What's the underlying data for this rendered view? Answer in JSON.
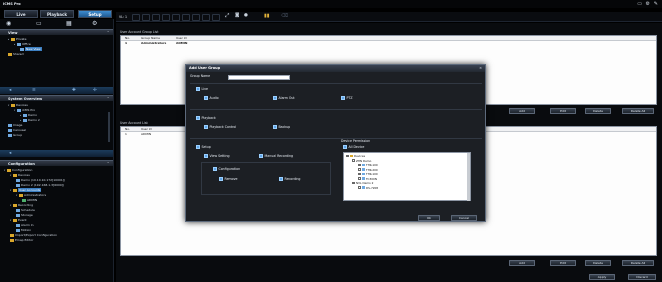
{
  "app": {
    "title": "iCMS Pro"
  },
  "window_controls": {
    "icons": [
      "screen-icon",
      "gear-icon",
      "pin-icon"
    ]
  },
  "tabs": [
    {
      "label": "Live"
    },
    {
      "label": "Playback"
    },
    {
      "label": "Setup",
      "active": true
    }
  ],
  "toolbar": {
    "view_label": "VL: 1"
  },
  "left_panel": {
    "view_section": {
      "label": "View"
    },
    "view_tree": [
      {
        "label": "Private",
        "type": "folder"
      },
      {
        "label": "Office",
        "type": "device"
      },
      {
        "label": "New View",
        "type": "view",
        "selected": true
      },
      {
        "label": "Shared",
        "type": "folder"
      }
    ],
    "system_overview": {
      "label": "System Overview"
    },
    "system_tree": [
      {
        "label": "Devices",
        "type": "folder"
      },
      {
        "label": "iCMS Pro",
        "type": "device"
      },
      {
        "label": "Demo",
        "type": "device"
      },
      {
        "label": "Demo 2",
        "type": "device"
      },
      {
        "label": "Image",
        "type": "folder"
      },
      {
        "label": "Carousel",
        "type": "folder"
      },
      {
        "label": "Group",
        "type": "folder"
      }
    ],
    "configuration_section": {
      "label": "Configuration"
    },
    "config_tree": [
      {
        "label": "Configuration",
        "type": "folder"
      },
      {
        "label": "Devices",
        "type": "folder"
      },
      {
        "label": "Demo (10.10.10.172[10001])",
        "type": "device"
      },
      {
        "label": "Demo 2 (192.168.1.3[6000])",
        "type": "device"
      },
      {
        "label": "User Accounts",
        "type": "folder",
        "selected": true
      },
      {
        "label": "Administrators",
        "type": "folder"
      },
      {
        "label": "ADMIN",
        "type": "user"
      },
      {
        "label": "Recording",
        "type": "folder"
      },
      {
        "label": "Schedule",
        "type": "device"
      },
      {
        "label": "Storage",
        "type": "device"
      },
      {
        "label": "Event",
        "type": "folder"
      },
      {
        "label": "Alarm In",
        "type": "device"
      },
      {
        "label": "Motion",
        "type": "device"
      },
      {
        "label": "Import/Export Configuration",
        "type": "folder"
      },
      {
        "label": "Emap Editor",
        "type": "folder"
      }
    ]
  },
  "user_account_group_list": {
    "title": "User Account Group List",
    "columns": [
      "No.",
      "Group Name",
      "User Id"
    ],
    "rows": [
      [
        "1",
        "Administrators",
        "ADMIN"
      ]
    ],
    "buttons": [
      "Add",
      "Edit",
      "Delete",
      "Delete All"
    ]
  },
  "user_account_list": {
    "title": "User Account List",
    "columns": [
      "No.",
      "User Id"
    ],
    "rows": [
      [
        "1",
        "ADMIN"
      ]
    ],
    "buttons": [
      "Add",
      "Edit",
      "Delete",
      "Delete All"
    ]
  },
  "footer_buttons": [
    "Apply",
    "Discard"
  ],
  "dialog": {
    "title": "Add User Group",
    "group_name_label": "Group Name",
    "group_name_value": "",
    "live": {
      "label": "Live",
      "options": [
        "Audio",
        "Alarm Out",
        "PTZ"
      ]
    },
    "playback": {
      "label": "Playback",
      "options": [
        "Playback Control",
        "Backup"
      ]
    },
    "setup": {
      "label": "Setup",
      "options": [
        "View Setting",
        "Manual Recording"
      ],
      "configuration": {
        "label": "Configuration",
        "options": [
          "Remove",
          "Recording"
        ]
      }
    },
    "device_permission": {
      "label": "Device Permission",
      "all_device_label": "All Device",
      "tree": [
        {
          "label": "Devices",
          "level": 0
        },
        {
          "label": "ZHN Demo",
          "level": 1
        },
        {
          "label": "THK-100",
          "level": 2
        },
        {
          "label": "THK-200",
          "level": 2
        },
        {
          "label": "THK-100",
          "level": 2
        },
        {
          "label": "TC300N",
          "level": 2
        },
        {
          "label": "NVL Demo 2",
          "level": 1
        },
        {
          "label": "DS-7208",
          "level": 2
        }
      ]
    },
    "ok_label": "Ok",
    "cancel_label": "Cancel"
  },
  "colors": {
    "accent": "#3c7fc2",
    "background": "#000000",
    "panel": "#1c1f24",
    "check": "#5ea4e8"
  }
}
